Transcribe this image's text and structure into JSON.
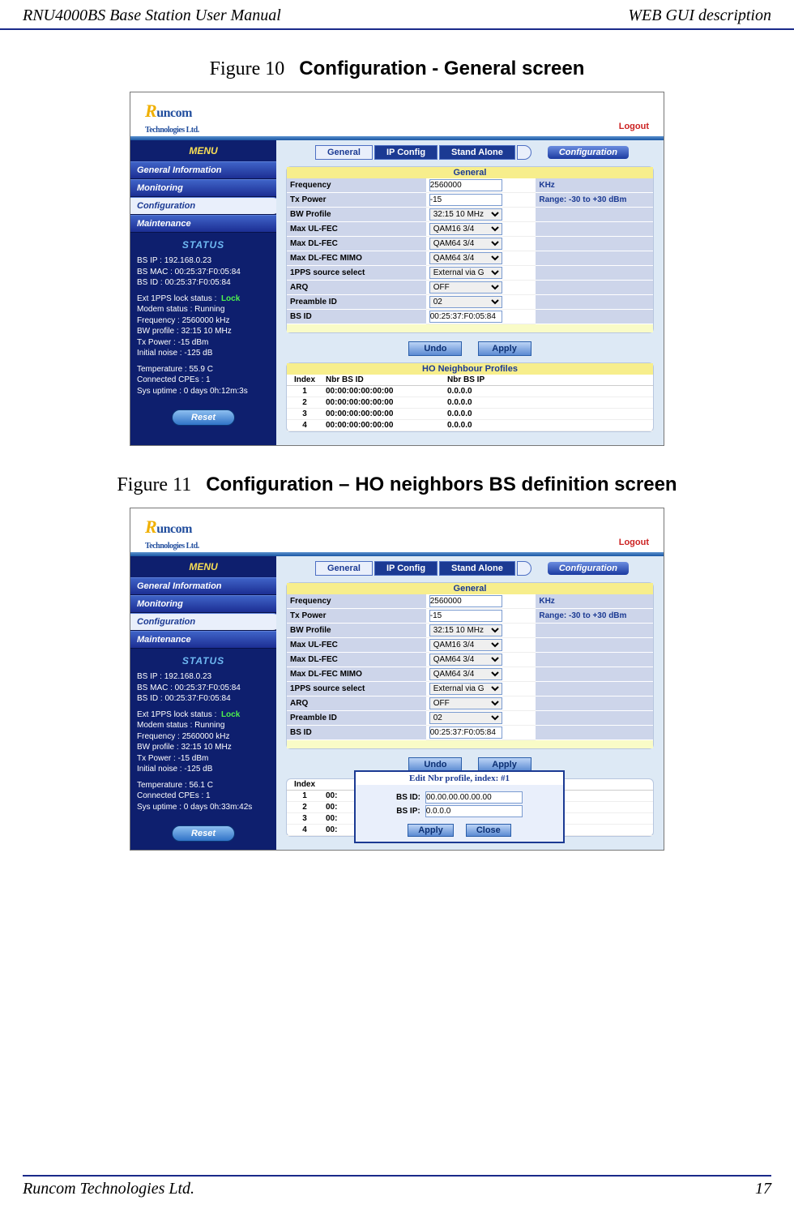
{
  "doc": {
    "header_left": "RNU4000BS Base Station User Manual",
    "header_right": "WEB GUI description",
    "footer_left": "Runcom Technologies Ltd.",
    "footer_right": "17",
    "caption10_no": "Figure 10",
    "caption10_title": "Configuration - General screen",
    "caption11_no": "Figure 11",
    "caption11_title": "Configuration – HO neighbors BS definition screen"
  },
  "ui": {
    "logo_main": "uncom",
    "logo_sub": "Technologies Ltd.",
    "logout": "Logout",
    "menu_title": "MENU",
    "menu": {
      "general_info": "General Information",
      "monitoring": "Monitoring",
      "configuration": "Configuration",
      "maintenance": "Maintenance"
    },
    "status_title": "STATUS",
    "status_a": {
      "bs_ip": "BS IP :  192.168.0.23",
      "bs_mac": "BS MAC :  00:25:37:F0:05:84",
      "bs_id": "BS ID :  00:25:37:F0:05:84",
      "pps_lbl": "Ext 1PPS lock status :",
      "pps_val": "Lock",
      "modem": "Modem status :  Running",
      "freq": "Frequency :  2560000 kHz",
      "bw": "BW profile :  32:15 10 MHz",
      "tx": "Tx Power :  -15 dBm",
      "noise": "Initial noise :  -125 dB",
      "temp": "Temperature :  55.9 C",
      "cpes": "Connected CPEs :  1",
      "uptime": "Sys uptime :  0 days 0h:12m:3s"
    },
    "status_b": {
      "temp": "Temperature :  56.1 C",
      "uptime": "Sys uptime :  0 days 0h:33m:42s"
    },
    "reset": "Reset",
    "tabs": {
      "general": "General",
      "ipconfig": "IP Config",
      "standalone": "Stand Alone"
    },
    "mode_badge": "Configuration",
    "general_panel": {
      "title": "General",
      "rows": [
        {
          "lbl": "Frequency",
          "val": "2560000",
          "type": "text",
          "extra": "KHz"
        },
        {
          "lbl": "Tx Power",
          "val": "-15",
          "type": "text",
          "extra": "Range: -30 to +30 dBm"
        },
        {
          "lbl": "BW Profile",
          "val": "32:15 10 MHz",
          "type": "select",
          "extra": ""
        },
        {
          "lbl": "Max UL-FEC",
          "val": "QAM16 3/4",
          "type": "select",
          "extra": ""
        },
        {
          "lbl": "Max DL-FEC",
          "val": "QAM64 3/4",
          "type": "select",
          "extra": ""
        },
        {
          "lbl": "Max DL-FEC MIMO",
          "val": "QAM64 3/4",
          "type": "select",
          "extra": ""
        },
        {
          "lbl": "1PPS source select",
          "val": "External via G",
          "type": "select",
          "extra": ""
        },
        {
          "lbl": "ARQ",
          "val": "OFF",
          "type": "select",
          "extra": ""
        },
        {
          "lbl": "Preamble ID",
          "val": "02",
          "type": "select",
          "extra": ""
        },
        {
          "lbl": "BS ID",
          "val": "00:25:37:F0:05:84",
          "type": "text",
          "extra": ""
        }
      ],
      "undo": "Undo",
      "apply": "Apply"
    },
    "nbr_panel": {
      "title": "HO Neighbour Profiles",
      "cols": {
        "idx": "Index",
        "bsid": "Nbr BS ID",
        "bsip": "Nbr BS IP"
      },
      "rows": [
        {
          "idx": "1",
          "bsid": "00:00:00:00:00:00",
          "bsip": "0.0.0.0"
        },
        {
          "idx": "2",
          "bsid": "00:00:00:00:00:00",
          "bsip": "0.0.0.0"
        },
        {
          "idx": "3",
          "bsid": "00:00:00:00:00:00",
          "bsip": "0.0.0.0"
        },
        {
          "idx": "4",
          "bsid": "00:00:00:00:00:00",
          "bsip": "0.0.0.0"
        }
      ],
      "rows_trunc": [
        {
          "idx": "1",
          "bsid": "00:"
        },
        {
          "idx": "2",
          "bsid": "00:"
        },
        {
          "idx": "3",
          "bsid": "00:"
        },
        {
          "idx": "4",
          "bsid": "00:"
        }
      ]
    },
    "dialog": {
      "title": "Edit Nbr profile, index: #1",
      "bsid_lbl": "BS ID:",
      "bsid_val": "00.00.00.00.00.00",
      "bsip_lbl": "BS IP:",
      "bsip_val": "0.0.0.0",
      "apply": "Apply",
      "close": "Close"
    }
  }
}
